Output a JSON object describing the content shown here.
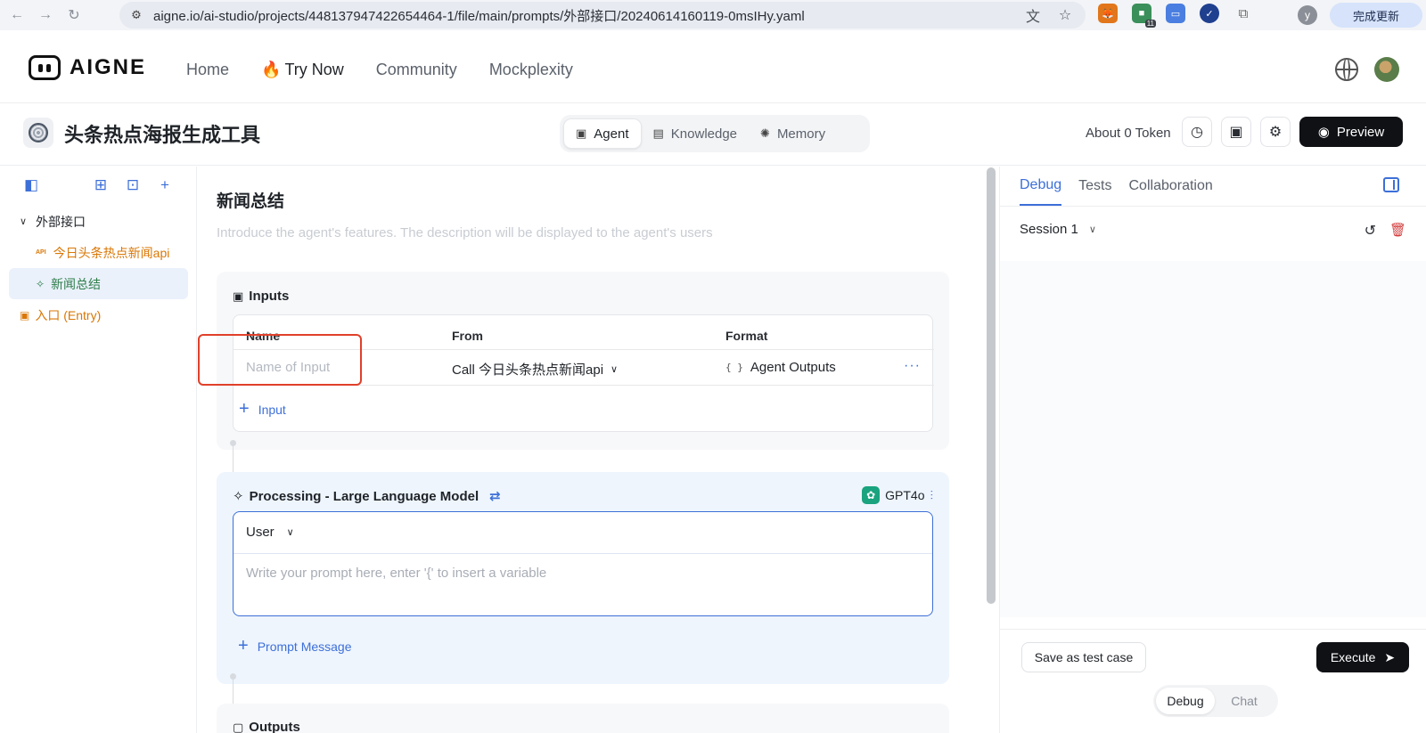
{
  "browser": {
    "url": "aigne.io/ai-studio/projects/448137947422654464-1/file/main/prompts/外部接口/20240614160119-0msIHy.yaml",
    "extension_badge": "11",
    "profile_letter": "y",
    "update_label": "完成更新"
  },
  "header": {
    "logo_text": "AIGNE",
    "nav": [
      "Home",
      "Try Now",
      "Community",
      "Mockplexity"
    ]
  },
  "project": {
    "title": "头条热点海报生成工具",
    "tabs": [
      {
        "label": "Agent",
        "icon": "robot-icon",
        "active": true
      },
      {
        "label": "Knowledge",
        "icon": "book-icon",
        "active": false
      },
      {
        "label": "Memory",
        "icon": "brain-icon",
        "active": false
      }
    ],
    "token_label": "About 0 Token",
    "preview_label": "Preview"
  },
  "sidebar": {
    "tree": [
      {
        "type": "folder",
        "label": "外部接口"
      },
      {
        "type": "api",
        "tag": "API",
        "label": "今日头条热点新闻api"
      },
      {
        "type": "agent",
        "label": "新闻总结",
        "selected": true
      },
      {
        "type": "entry",
        "label": "入口 (Entry)"
      }
    ]
  },
  "editor": {
    "agent_name": "新闻总结",
    "description_placeholder": "Introduce the agent's features. The description will be displayed to the agent's users",
    "inputs": {
      "title": "Inputs",
      "columns": [
        "Name",
        "From",
        "Format"
      ],
      "row": {
        "name_placeholder": "Name of Input",
        "from": "Call 今日头条热点新闻api",
        "format": "Agent Outputs",
        "format_icon": "{ }"
      },
      "add_label": "Input"
    },
    "processing": {
      "title": "Processing -  Large Language Model",
      "model": "GPT4o",
      "role": "User",
      "prompt_placeholder": "Write your prompt here, enter '{' to insert a variable",
      "add_label": "Prompt Message"
    },
    "outputs": {
      "title": "Outputs"
    }
  },
  "right_panel": {
    "tabs": [
      "Debug",
      "Tests",
      "Collaboration"
    ],
    "active_tab": "Debug",
    "session": "Session 1",
    "save_case_label": "Save as test case",
    "execute_label": "Execute",
    "modes": [
      "Debug",
      "Chat"
    ],
    "active_mode": "Debug"
  },
  "colors": {
    "accent": "#3d6fd8",
    "primary_dark": "#0f1115",
    "api_orange": "#d97706",
    "selected_green": "#2e7d4a",
    "highlight_red": "#e0402a"
  }
}
